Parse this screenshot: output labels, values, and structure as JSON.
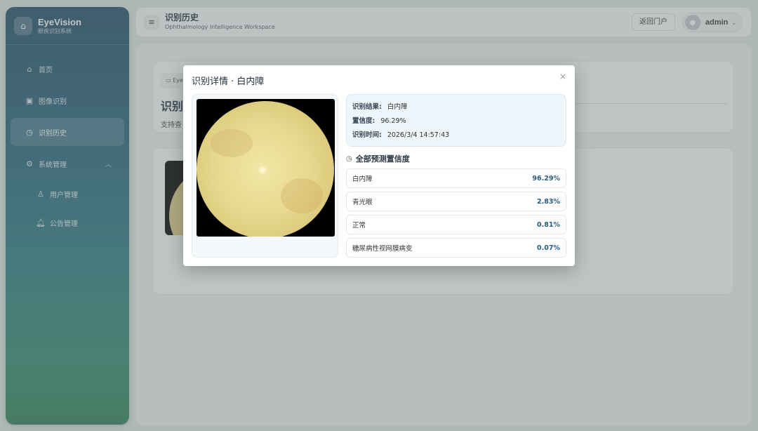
{
  "brand": {
    "title": "EyeVision",
    "subtitle": "眼疾识别系统",
    "logo_icon": "home-icon"
  },
  "sidebar": {
    "items": [
      {
        "label": "首页",
        "icon": "home-icon"
      },
      {
        "label": "图像识别",
        "icon": "image-icon"
      },
      {
        "label": "识别历史",
        "icon": "clock-icon",
        "active": true
      },
      {
        "label": "系统管理",
        "icon": "gear-icon",
        "expanded": true
      },
      {
        "label": "用户管理",
        "icon": "user-icon"
      },
      {
        "label": "公告管理",
        "icon": "bell-icon"
      }
    ]
  },
  "header": {
    "title": "识别历史",
    "subtitle": "Ophthalmology Intelligence Workspace",
    "portal_button": "返回门户",
    "username": "admin"
  },
  "page": {
    "breadcrumb": "Eye",
    "title": "识别",
    "description": "支持查"
  },
  "modal": {
    "title": "识别详情 · 白内障",
    "close": "×",
    "result_label": "识别结果:",
    "result_value": "白内障",
    "confidence_label": "置信度:",
    "confidence_value": "96.29%",
    "time_label": "识别时间:",
    "time_value": "2026/3/4 14:57:43",
    "predictions_title": "全部预测置信度",
    "predictions": [
      {
        "name": "白内障",
        "value": "96.29%"
      },
      {
        "name": "青光眼",
        "value": "2.83%"
      },
      {
        "name": "正常",
        "value": "0.81%"
      },
      {
        "name": "糖尿病性视网膜病变",
        "value": "0.07%"
      }
    ]
  },
  "colors": {
    "accent": "#2b5b7c",
    "sidebar_top": "#1f4d66",
    "sidebar_bottom": "#2b7d55"
  }
}
